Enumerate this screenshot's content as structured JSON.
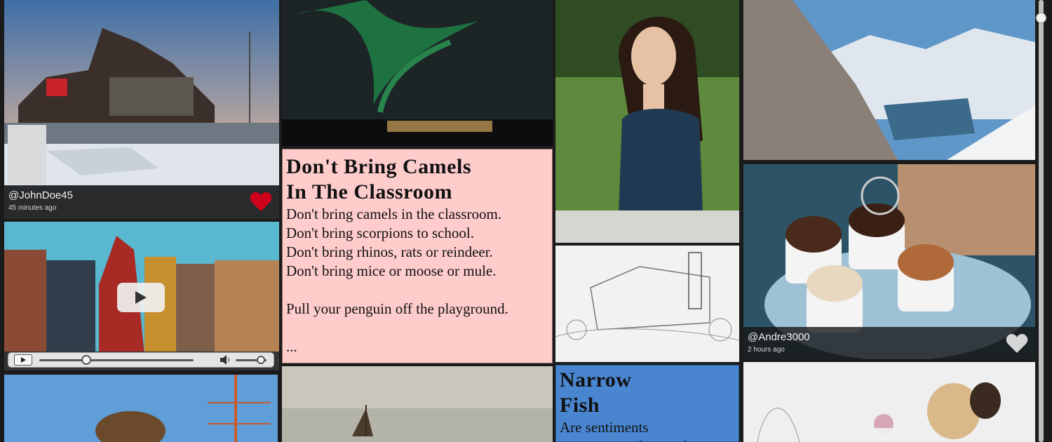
{
  "posts": [
    {
      "user": "@JohnDoe45",
      "time": "45 minutes ago",
      "liked": true
    },
    {
      "user": "@Andre3000",
      "time": "2 hours ago",
      "liked": false
    }
  ],
  "text_cards": [
    {
      "title": "Don't Bring Camels\nIn The Classroom",
      "body": "Don't bring camels in the classroom.\nDon't bring scorpions to school.\nDon't bring rhinos, rats or reindeer.\nDon't bring mice or moose or mule.\n\nPull your penguin off the playground.\n\n...",
      "background": "#ffcccc"
    },
    {
      "title": "Narrow\nFish",
      "body": "Are sentiments\nconsequents decisively",
      "background": "#4a86d0"
    }
  ],
  "colors": {
    "heart_liked": "#d0021b",
    "heart_unliked": "#d6d6d6"
  }
}
